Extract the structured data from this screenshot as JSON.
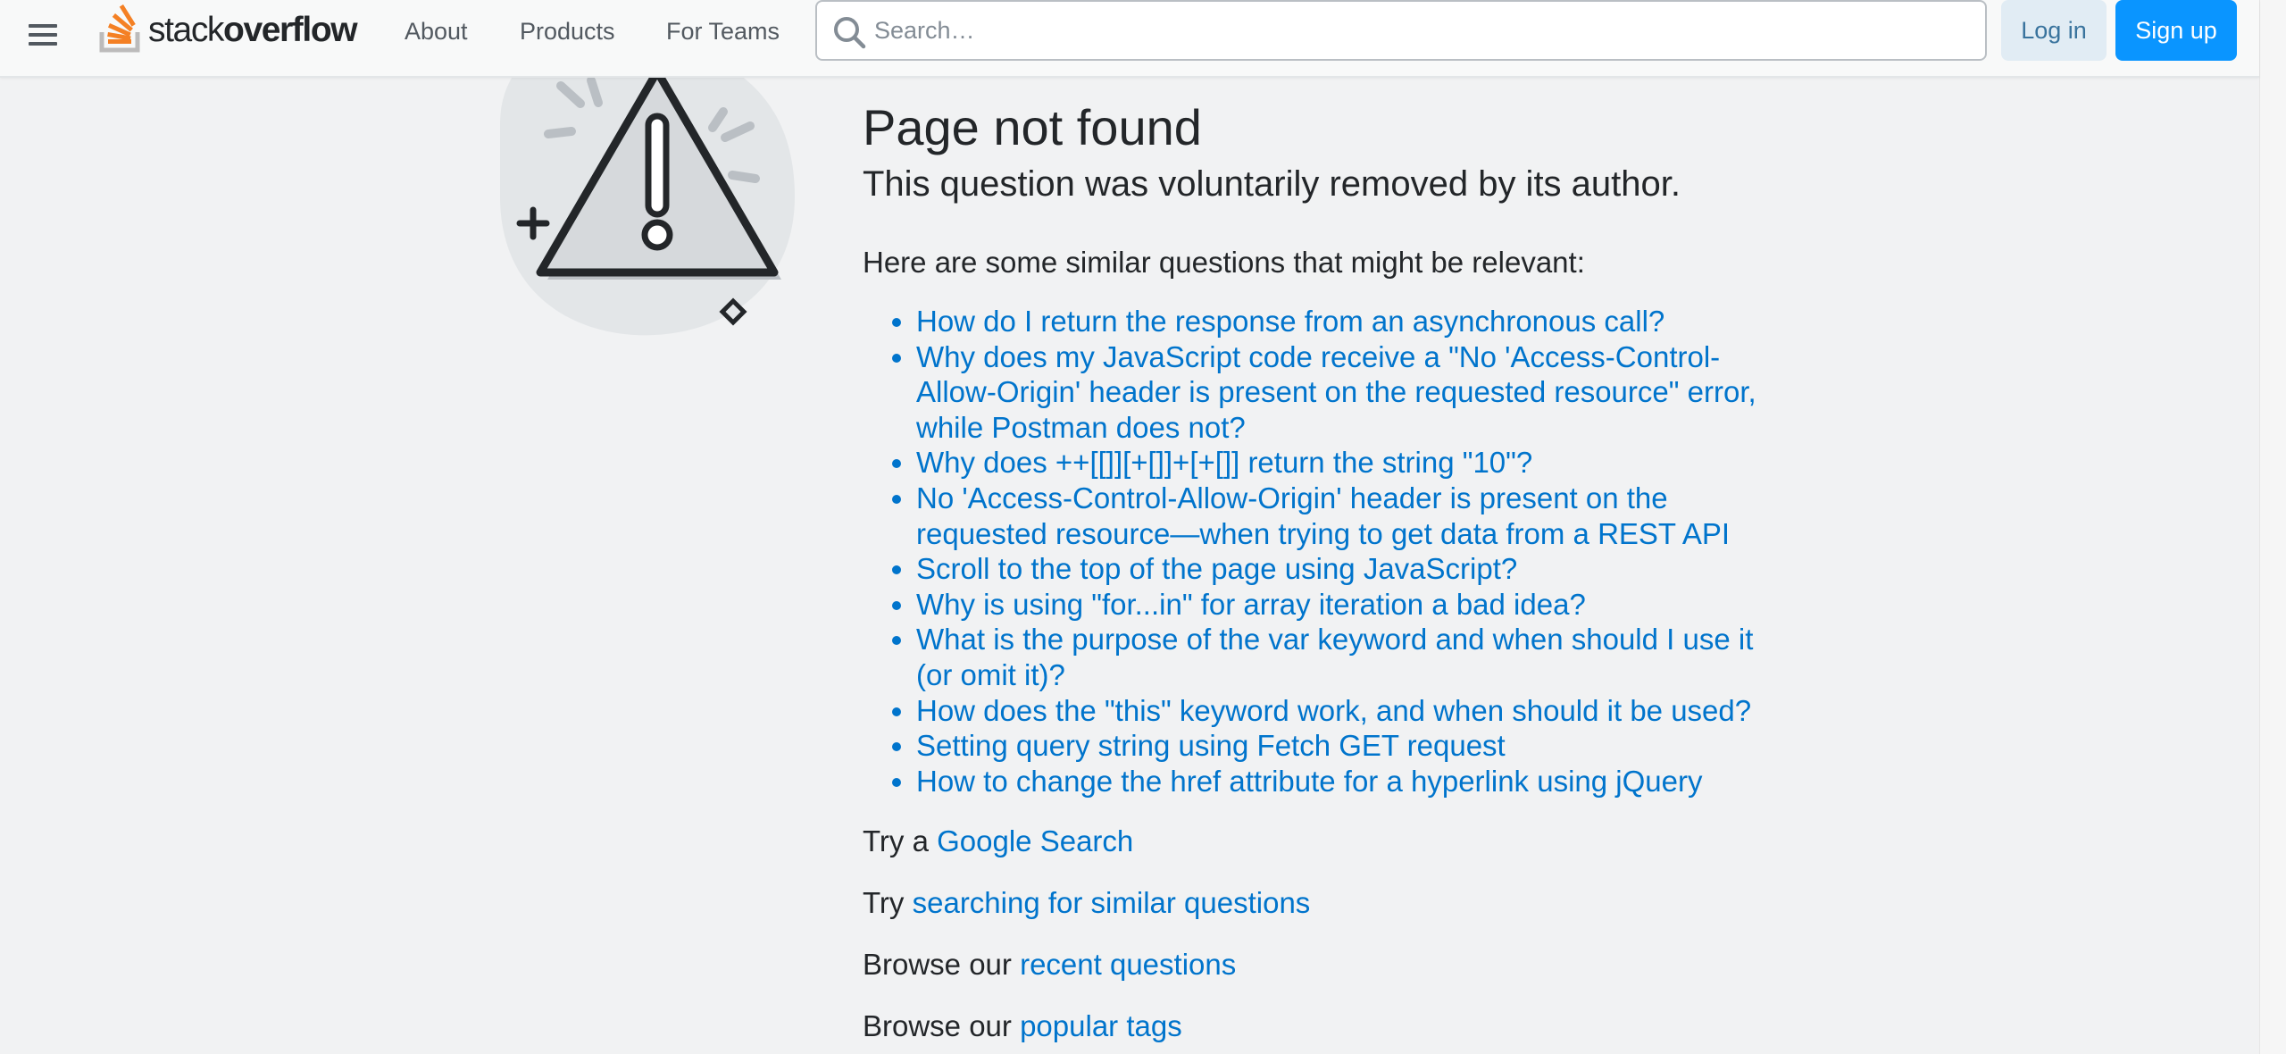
{
  "header": {
    "logo_text_light": "stack",
    "logo_text_bold": "overflow",
    "nav": [
      "About",
      "Products",
      "For Teams"
    ],
    "search_placeholder": "Search…",
    "login_label": "Log in",
    "signup_label": "Sign up"
  },
  "main": {
    "title": "Page not found",
    "subtitle": "This question was voluntarily removed by its author.",
    "intro": "Here are some similar questions that might be relevant:",
    "questions": [
      "How do I return the response from an asynchronous call?",
      "Why does my JavaScript code receive a \"No 'Access-Control-Allow-Origin' header is present on the requested resource\" error, while Postman does not?",
      "Why does ++[[]][+[]]+[+[]] return the string \"10\"?",
      "No 'Access-Control-Allow-Origin' header is present on the requested resource—when trying to get data from a REST API",
      "Scroll to the top of the page using JavaScript?",
      "Why is using \"for...in\" for array iteration a bad idea?",
      "What is the purpose of the var keyword and when should I use it (or omit it)?",
      "How does the \"this\" keyword work, and when should it be used?",
      "Setting query string using Fetch GET request",
      "How to change the href attribute for a hyperlink using jQuery"
    ],
    "try_google_prefix": "Try a",
    "try_google_link": "Google Search",
    "try_search_prefix": "Try",
    "try_search_link": "searching for similar questions",
    "browse_recent_prefix": "Browse our",
    "browse_recent_link": "recent questions",
    "browse_tags_prefix": "Browse our",
    "browse_tags_link": "popular tags"
  },
  "colors": {
    "link": "#0074cc",
    "accent": "#0a95ff",
    "brand_orange": "#f48024",
    "background": "#f1f2f3"
  },
  "icons": [
    "hamburger-icon",
    "stackoverflow-logo-icon",
    "search-icon",
    "warning-triangle-icon"
  ]
}
